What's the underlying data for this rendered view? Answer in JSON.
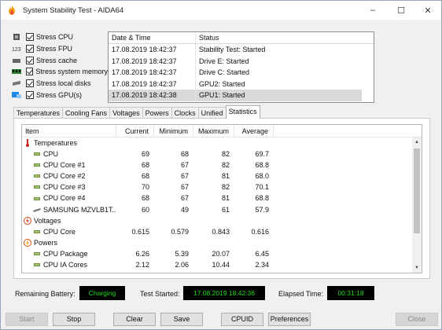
{
  "window": {
    "title": "System Stability Test - AIDA64",
    "controls": [
      "–",
      "☐",
      "✕"
    ]
  },
  "stress_options": [
    {
      "label": "Stress CPU",
      "icon": "cpu-chip-icon",
      "checked": true
    },
    {
      "label": "Stress FPU",
      "icon": "fpu-chip-icon",
      "checked": true
    },
    {
      "label": "Stress cache",
      "icon": "cache-icon",
      "checked": true
    },
    {
      "label": "Stress system memory",
      "icon": "memory-module-icon",
      "checked": true
    },
    {
      "label": "Stress local disks",
      "icon": "hard-disk-icon",
      "checked": true
    },
    {
      "label": "Stress GPU(s)",
      "icon": "gpu-icon",
      "checked": true
    }
  ],
  "log": {
    "columns": [
      "Date & Time",
      "Status"
    ],
    "rows": [
      {
        "datetime": "17.08.2019 18:42:37",
        "status": "Stability Test: Started"
      },
      {
        "datetime": "17.08.2019 18:42:37",
        "status": "Drive E: Started"
      },
      {
        "datetime": "17.08.2019 18:42:37",
        "status": "Drive C: Started"
      },
      {
        "datetime": "17.08.2019 18:42:37",
        "status": "GPU2: Started"
      },
      {
        "datetime": "17.08.2019 18:42:38",
        "status": "GPU1: Started"
      }
    ]
  },
  "tabs": [
    "Temperatures",
    "Cooling Fans",
    "Voltages",
    "Powers",
    "Clocks",
    "Unified",
    "Statistics"
  ],
  "active_tab": "Statistics",
  "stats": {
    "columns": [
      "Item",
      "Current",
      "Minimum",
      "Maximum",
      "Average"
    ],
    "rows": [
      {
        "kind": "group",
        "icon": "thermometer-icon",
        "item": "Temperatures",
        "current": "",
        "minimum": "",
        "maximum": "",
        "average": ""
      },
      {
        "kind": "sub",
        "icon": "chip-icon",
        "item": "CPU",
        "current": "69",
        "minimum": "68",
        "maximum": "82",
        "average": "69.7"
      },
      {
        "kind": "sub",
        "icon": "chip-icon",
        "item": "CPU Core #1",
        "current": "68",
        "minimum": "67",
        "maximum": "82",
        "average": "68.8"
      },
      {
        "kind": "sub",
        "icon": "chip-icon",
        "item": "CPU Core #2",
        "current": "68",
        "minimum": "67",
        "maximum": "81",
        "average": "68.0"
      },
      {
        "kind": "sub",
        "icon": "chip-icon",
        "item": "CPU Core #3",
        "current": "70",
        "minimum": "67",
        "maximum": "82",
        "average": "70.1"
      },
      {
        "kind": "sub",
        "icon": "chip-icon",
        "item": "CPU Core #4",
        "current": "68",
        "minimum": "67",
        "maximum": "81",
        "average": "68.8"
      },
      {
        "kind": "sub",
        "icon": "disk-icon",
        "item": "SAMSUNG MZVLB1T...",
        "current": "60",
        "minimum": "49",
        "maximum": "61",
        "average": "57.9"
      },
      {
        "kind": "group",
        "icon": "voltage-icon",
        "item": "Voltages",
        "current": "",
        "minimum": "",
        "maximum": "",
        "average": ""
      },
      {
        "kind": "sub",
        "icon": "chip-icon",
        "item": "CPU Core",
        "current": "0.615",
        "minimum": "0.579",
        "maximum": "0.843",
        "average": "0.616"
      },
      {
        "kind": "group",
        "icon": "power-icon",
        "item": "Powers",
        "current": "",
        "minimum": "",
        "maximum": "",
        "average": ""
      },
      {
        "kind": "sub",
        "icon": "chip-icon",
        "item": "CPU Package",
        "current": "6.26",
        "minimum": "5.39",
        "maximum": "20.07",
        "average": "6.45"
      },
      {
        "kind": "sub",
        "icon": "chip-icon",
        "item": "CPU IA Cores",
        "current": "2.12",
        "minimum": "2.06",
        "maximum": "10.44",
        "average": "2.34"
      }
    ]
  },
  "status": {
    "battery_label": "Remaining Battery:",
    "battery_value": "Charging",
    "started_label": "Test Started:",
    "started_value": "17.08.2019 18:42:36",
    "elapsed_label": "Elapsed Time:",
    "elapsed_value": "00:31:18",
    "value_color": "#22dd22"
  },
  "buttons": {
    "start": "Start",
    "stop": "Stop",
    "clear": "Clear",
    "save": "Save",
    "cpuid": "CPUID",
    "preferences": "Preferences",
    "close": "Close"
  }
}
